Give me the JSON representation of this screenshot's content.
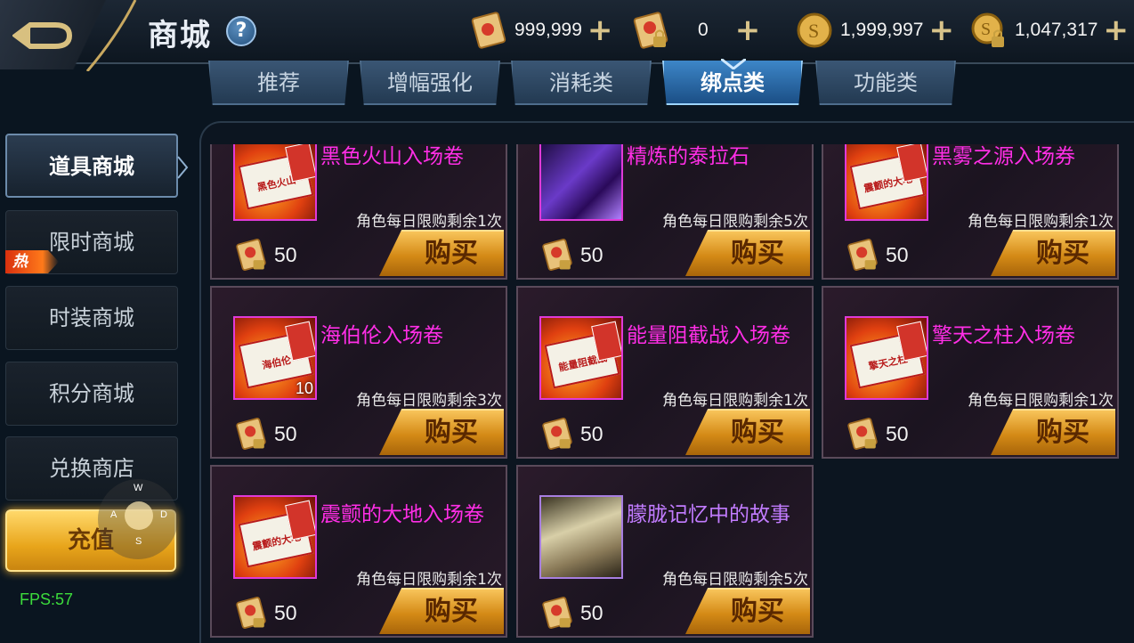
{
  "header": {
    "title": "商城",
    "currencies": [
      {
        "icon": "scroll-ticket-icon",
        "value": "999,999"
      },
      {
        "icon": "locked-scroll-ticket-icon",
        "value": "0"
      },
      {
        "icon": "gold-coin-icon",
        "value": "1,999,997"
      },
      {
        "icon": "locked-gold-coin-icon",
        "value": "1,047,317"
      }
    ]
  },
  "tabs": [
    {
      "label": "推荐",
      "active": false
    },
    {
      "label": "增幅强化",
      "active": false
    },
    {
      "label": "消耗类",
      "active": false
    },
    {
      "label": "绑点类",
      "active": true
    },
    {
      "label": "功能类",
      "active": false
    }
  ],
  "sidebar": {
    "items": [
      {
        "label": "道具商城",
        "active": true
      },
      {
        "label": "限时商城",
        "active": false,
        "badge": "热"
      },
      {
        "label": "时装商城",
        "active": false
      },
      {
        "label": "积分商城",
        "active": false
      },
      {
        "label": "兑换商店",
        "active": false
      }
    ],
    "recharge": "充值"
  },
  "joystick": {
    "w": "W",
    "a": "A",
    "s": "S",
    "d": "D"
  },
  "fps": "FPS:57",
  "items": [
    {
      "name": "黑色火山入场卷",
      "ticket_text": "黑色火山",
      "limit": "角色每日限购剩余1次",
      "price": "50",
      "buy": "购买",
      "kind": "ticket"
    },
    {
      "name": "精炼的泰拉石",
      "limit": "角色每日限购剩余5次",
      "price": "50",
      "buy": "购买",
      "kind": "purple"
    },
    {
      "name": "黑雾之源入场券",
      "ticket_text": "震颤的大地",
      "limit": "角色每日限购剩余1次",
      "price": "50",
      "buy": "购买",
      "kind": "ticket"
    },
    {
      "name": "海伯伦入场卷",
      "ticket_text": "海伯伦",
      "qty": "10",
      "limit": "角色每日限购剩余3次",
      "price": "50",
      "buy": "购买",
      "kind": "ticket"
    },
    {
      "name": "能量阻截战入场卷",
      "ticket_text": "能量阻截战",
      "limit": "角色每日限购剩余1次",
      "price": "50",
      "buy": "购买",
      "kind": "ticket"
    },
    {
      "name": "擎天之柱入场卷",
      "ticket_text": "擎天之柱",
      "limit": "角色每日限购剩余1次",
      "price": "50",
      "buy": "购买",
      "kind": "ticket"
    },
    {
      "name": "震颤的大地入场卷",
      "ticket_text": "震颤的大地",
      "limit": "角色每日限购剩余1次",
      "price": "50",
      "buy": "购买",
      "kind": "ticket"
    },
    {
      "name": "朦胧记忆中的故事",
      "limit": "角色每日限购剩余5次",
      "price": "50",
      "buy": "购买",
      "kind": "story"
    }
  ]
}
